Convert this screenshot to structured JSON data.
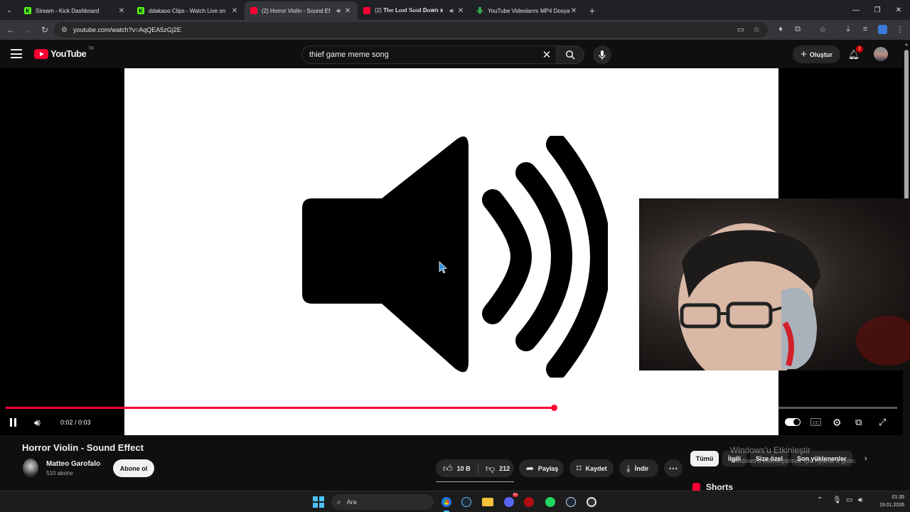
{
  "browser": {
    "tabs": [
      {
        "title": "Stream - Kick Dashboard",
        "icon": "kick-icon",
        "active": false,
        "audio": false
      },
      {
        "title": "ddakaoo Clips - Watch Live on",
        "icon": "kick-icon",
        "active": false,
        "audio": false
      },
      {
        "title": "(2) Horror Violin - Sound Ef",
        "icon": "youtube-icon",
        "active": true,
        "audio": true
      },
      {
        "title": "(2) 𝐓𝐡𝐞 𝐋𝐨𝐬𝐭 𝐒𝐨𝐮𝐥 𝐃𝐨𝐰𝐧 𝐱",
        "icon": "youtube-icon",
        "active": false,
        "audio": true
      },
      {
        "title": "YouTube Videolarını MP4 Dosya",
        "icon": "download-icon",
        "active": false,
        "audio": false
      }
    ],
    "url": "youtube.com/watch?v=AqQEA5zGj2E",
    "kick_letter": "K"
  },
  "youtube": {
    "logo_text": "YouTube",
    "country_code": "TR",
    "search_query": "thief game meme song",
    "create_label": "Oluştur",
    "notification_count": "2"
  },
  "player": {
    "time_display": "0:02 / 0:03",
    "progress": 0.615,
    "accent": "#ff0033"
  },
  "video": {
    "title": "Horror Violin - Sound Effect",
    "channel": "Matteo Garofalo",
    "subscribers": "510 abone",
    "subscribe_label": "Abone ol",
    "likes": "10 B",
    "dislikes": "212",
    "share_label": "Paylaş",
    "save_label": "Kaydet",
    "download_label": "İndir"
  },
  "sidebar": {
    "chips": [
      "Tümü",
      "İlgili",
      "Size özel",
      "Son yüklenenler"
    ],
    "shorts_label": "Shorts"
  },
  "watermark": {
    "title": "Windows'u Etkinleştir",
    "subtitle": "Windows'u etkinleştirmek için Ayarlar'a gidin."
  },
  "taskbar": {
    "search_placeholder": "Ara",
    "time": "01:35",
    "date": "19.01.2026",
    "discord_badge": "9+"
  }
}
